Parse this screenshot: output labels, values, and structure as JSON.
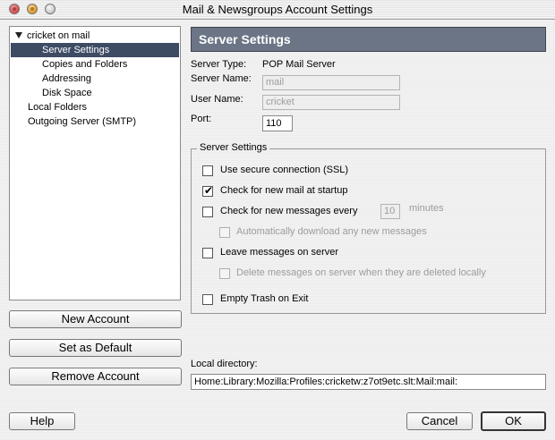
{
  "window": {
    "title": "Mail & Newsgroups Account Settings"
  },
  "tree": {
    "items": [
      {
        "label": "cricket on mail"
      },
      {
        "label": "Server Settings"
      },
      {
        "label": "Copies and Folders"
      },
      {
        "label": "Addressing"
      },
      {
        "label": "Disk Space"
      },
      {
        "label": "Local Folders"
      },
      {
        "label": "Outgoing Server (SMTP)"
      }
    ]
  },
  "left_buttons": {
    "new_account": "New Account",
    "set_default": "Set as Default",
    "remove_account": "Remove Account"
  },
  "panel": {
    "header": "Server Settings",
    "server_type_label": "Server Type:",
    "server_type_value": "POP Mail Server",
    "server_name_label": "Server Name:",
    "server_name_value": "mail",
    "user_name_label": "User Name:",
    "user_name_value": "cricket",
    "port_label": "Port:",
    "port_value": "110",
    "group_legend": "Server Settings",
    "options": {
      "secure": {
        "label": "Use secure connection (SSL)",
        "checked": false
      },
      "check_startup": {
        "label": "Check for new mail at startup",
        "checked": true
      },
      "check_every": {
        "label": "Check for new messages every",
        "checked": false,
        "minutes_value": "10",
        "minutes_label": "minutes"
      },
      "auto_download": {
        "label": "Automatically download any new messages",
        "checked": false
      },
      "leave_on_server": {
        "label": "Leave messages on server",
        "checked": false
      },
      "delete_on_server": {
        "label": "Delete messages on server when they are deleted locally",
        "checked": false
      },
      "empty_trash": {
        "label": "Empty Trash on Exit",
        "checked": false
      }
    },
    "local_dir_label": "Local directory:",
    "local_dir_value": "Home:Library:Mozilla:Profiles:cricketw:z7ot9etc.slt:Mail:mail:"
  },
  "footer": {
    "help": "Help",
    "cancel": "Cancel",
    "ok": "OK"
  }
}
